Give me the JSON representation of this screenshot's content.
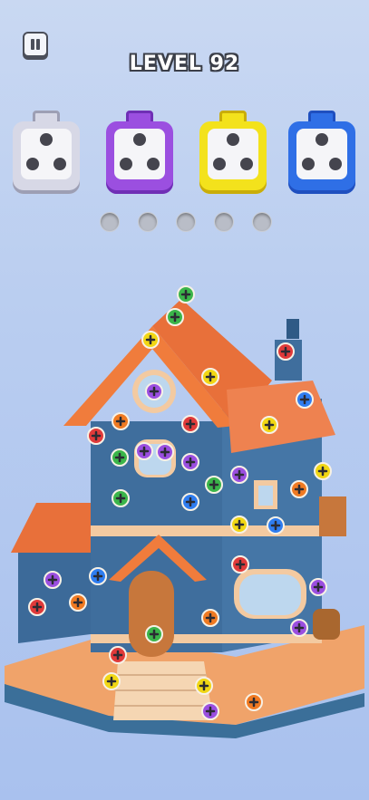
{
  "hud": {
    "level_text": "LEVEL  92",
    "pause_icon": "pause-icon"
  },
  "boxes": [
    {
      "color": "#d7d8e6",
      "dark": "#9d9fb4",
      "dots": 3
    },
    {
      "color": "#9b4fe0",
      "dark": "#6f2fb5",
      "dots": 3
    },
    {
      "color": "#f3e21c",
      "dark": "#c9ad09",
      "dots": 3
    },
    {
      "color": "#2f6fe6",
      "dark": "#1f4fbf",
      "dots": 3
    }
  ],
  "slots": {
    "count": 5,
    "filled": 0
  },
  "screw_colors": {
    "red": "#e03a3a",
    "orange": "#f07a22",
    "yellow": "#f1d714",
    "green": "#3bb54a",
    "blue": "#2f7df0",
    "purple": "#9b4fe0",
    "white": "#e8e8ef"
  }
}
